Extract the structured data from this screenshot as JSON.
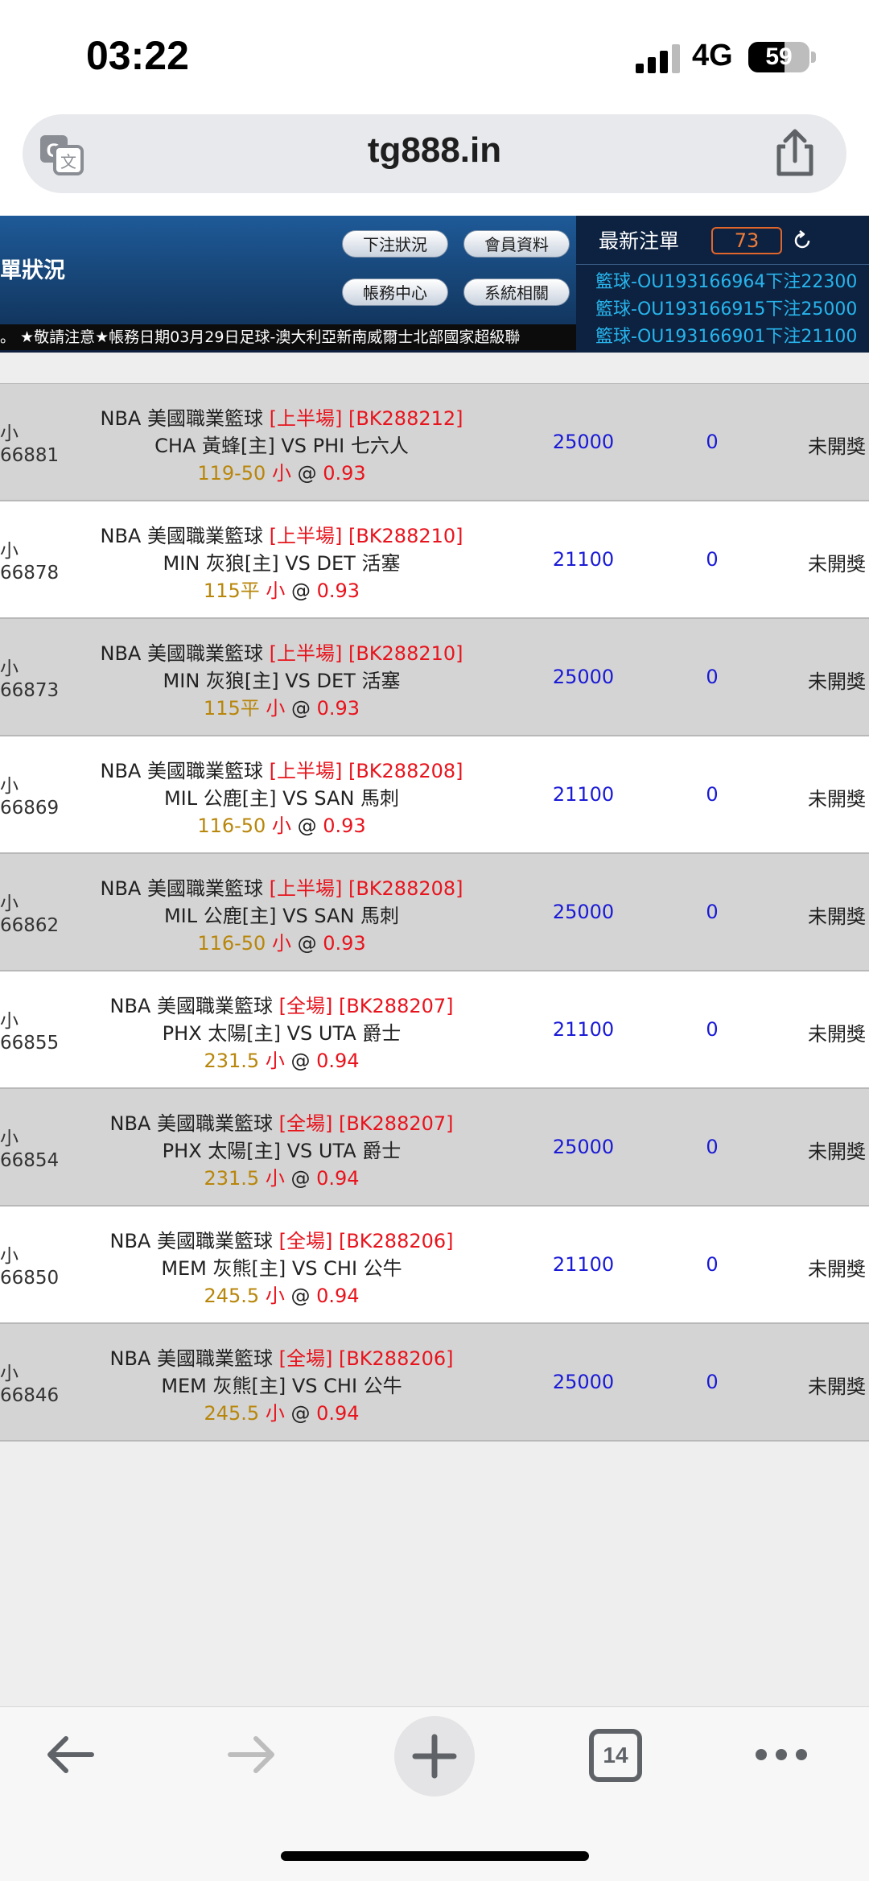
{
  "status_bar": {
    "time": "03:22",
    "network": "4G",
    "battery": "59",
    "battery_level": 0.59
  },
  "url_bar": {
    "url": "tg888.in",
    "translate_icon": "translate-icon",
    "share_icon": "share-icon"
  },
  "header": {
    "title": "單狀況",
    "buttons": [
      "下注狀況",
      "會員資料",
      "帳務中心",
      "系統相關"
    ],
    "ticker": "。 ★敬請注意★帳務日期03月29日足球-澳大利亞新南威爾士北部國家超級聯",
    "latest": {
      "title": "最新注單",
      "count": "73",
      "lines": [
        "籃球-OU193166964下注22300",
        "籃球-OU193166915下注25000",
        "籃球-OU193166901下注21100"
      ]
    }
  },
  "bets": [
    {
      "type": "小",
      "id": "66881",
      "league": "NBA 美國職業籃球",
      "period": "[上半場]",
      "code": "[BK288212]",
      "match": "CHA 黃蜂[主] VS PHI 七六人",
      "line": "119-50",
      "pick": "小",
      "odds": "0.93",
      "amount": "25000",
      "win": "0",
      "status": "未開獎"
    },
    {
      "type": "小",
      "id": "66878",
      "league": "NBA 美國職業籃球",
      "period": "[上半場]",
      "code": "[BK288210]",
      "match": "MIN 灰狼[主] VS DET 活塞",
      "line": "115平",
      "pick": "小",
      "odds": "0.93",
      "amount": "21100",
      "win": "0",
      "status": "未開獎"
    },
    {
      "type": "小",
      "id": "66873",
      "league": "NBA 美國職業籃球",
      "period": "[上半場]",
      "code": "[BK288210]",
      "match": "MIN 灰狼[主] VS DET 活塞",
      "line": "115平",
      "pick": "小",
      "odds": "0.93",
      "amount": "25000",
      "win": "0",
      "status": "未開獎"
    },
    {
      "type": "小",
      "id": "66869",
      "league": "NBA 美國職業籃球",
      "period": "[上半場]",
      "code": "[BK288208]",
      "match": "MIL 公鹿[主] VS SAN 馬刺",
      "line": "116-50",
      "pick": "小",
      "odds": "0.93",
      "amount": "21100",
      "win": "0",
      "status": "未開獎"
    },
    {
      "type": "小",
      "id": "66862",
      "league": "NBA 美國職業籃球",
      "period": "[上半場]",
      "code": "[BK288208]",
      "match": "MIL 公鹿[主] VS SAN 馬刺",
      "line": "116-50",
      "pick": "小",
      "odds": "0.93",
      "amount": "25000",
      "win": "0",
      "status": "未開獎"
    },
    {
      "type": "小",
      "id": "66855",
      "league": "NBA 美國職業籃球",
      "period": "[全場]",
      "code": "[BK288207]",
      "match": "PHX 太陽[主] VS UTA 爵士",
      "line": "231.5",
      "pick": "小",
      "odds": "0.94",
      "amount": "21100",
      "win": "0",
      "status": "未開獎"
    },
    {
      "type": "小",
      "id": "66854",
      "league": "NBA 美國職業籃球",
      "period": "[全場]",
      "code": "[BK288207]",
      "match": "PHX 太陽[主] VS UTA 爵士",
      "line": "231.5",
      "pick": "小",
      "odds": "0.94",
      "amount": "25000",
      "win": "0",
      "status": "未開獎"
    },
    {
      "type": "小",
      "id": "66850",
      "league": "NBA 美國職業籃球",
      "period": "[全場]",
      "code": "[BK288206]",
      "match": "MEM 灰熊[主] VS CHI 公牛",
      "line": "245.5",
      "pick": "小",
      "odds": "0.94",
      "amount": "21100",
      "win": "0",
      "status": "未開獎"
    },
    {
      "type": "小",
      "id": "66846",
      "league": "NBA 美國職業籃球",
      "period": "[全場]",
      "code": "[BK288206]",
      "match": "MEM 灰熊[主] VS CHI 公牛",
      "line": "245.5",
      "pick": "小",
      "odds": "0.94",
      "amount": "25000",
      "win": "0",
      "status": "未開獎"
    }
  ],
  "toolbar": {
    "tabs_count": "14",
    "icons": [
      "back-arrow-icon",
      "forward-arrow-icon",
      "new-tab-plus-icon",
      "tabs-icon",
      "more-icon"
    ]
  }
}
